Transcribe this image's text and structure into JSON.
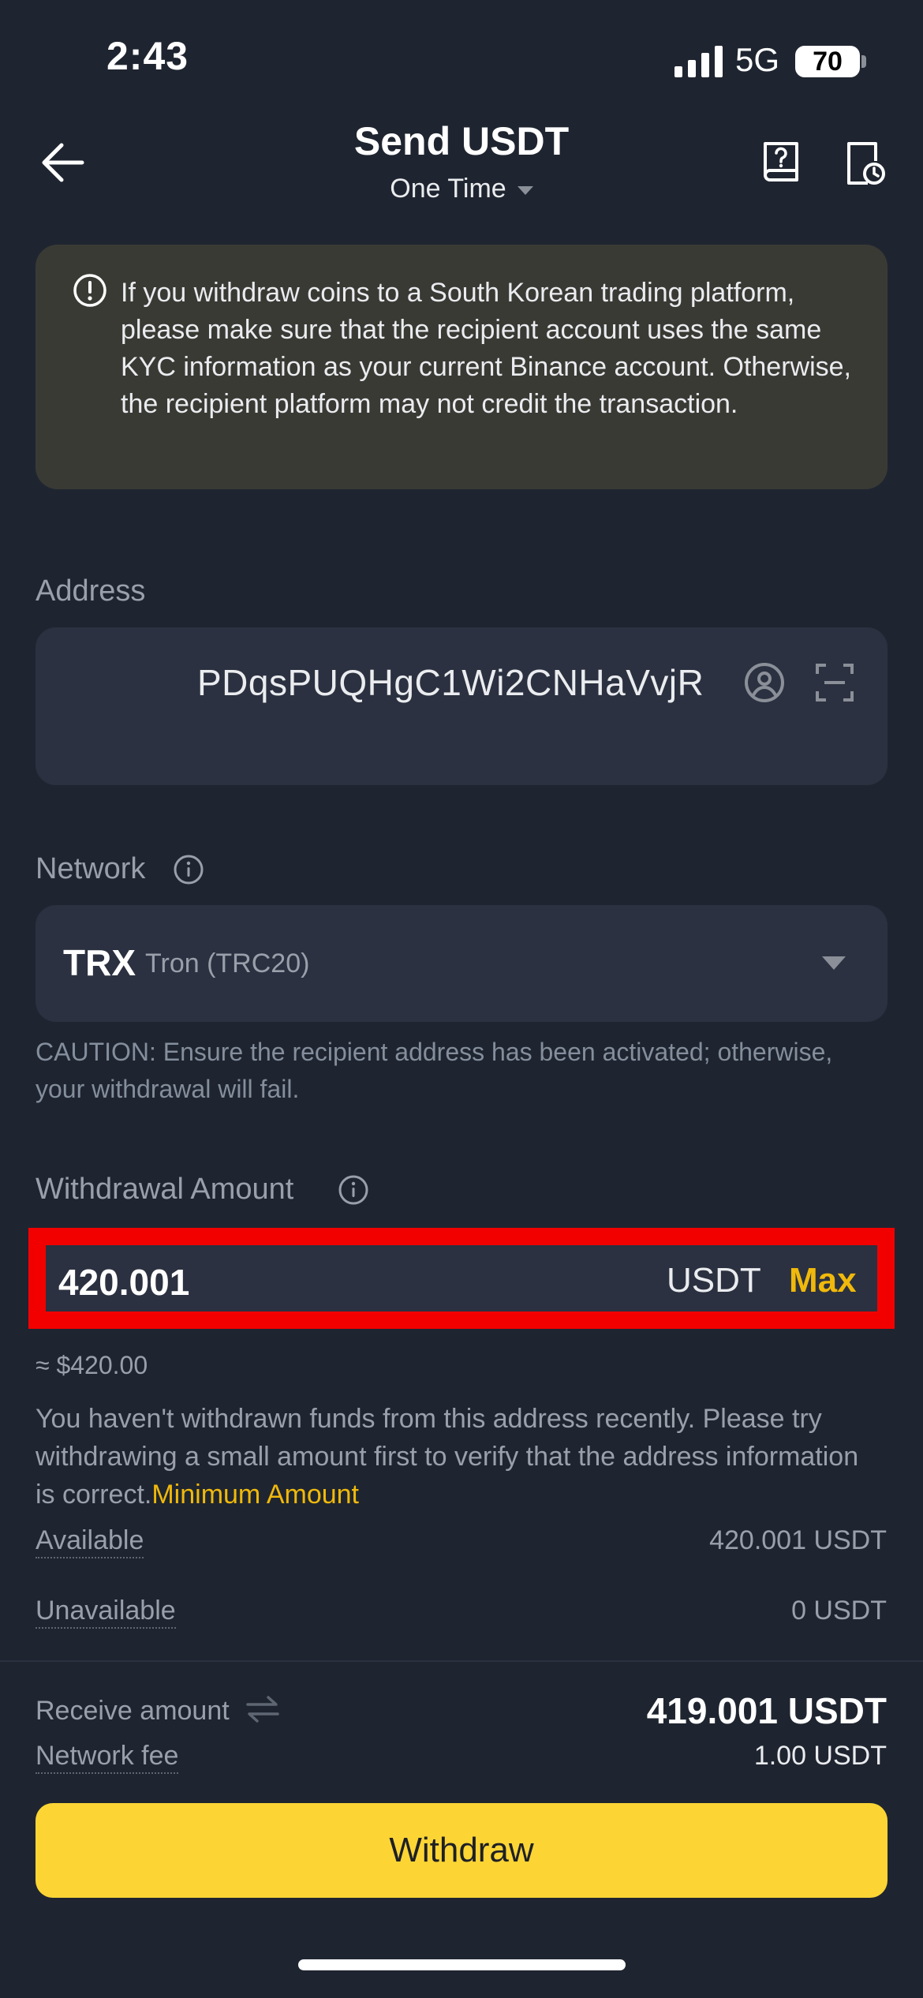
{
  "status_bar": {
    "time": "2:43",
    "network": "5G",
    "battery": "70"
  },
  "header": {
    "title": "Send USDT",
    "subtitle": "One Time"
  },
  "warning": {
    "text": "If you withdraw coins to a South Korean trading platform, please make sure that the recipient account uses the same KYC information as your current Binance account. Otherwise, the recipient platform may not credit the transaction."
  },
  "address": {
    "label": "Address",
    "value": "PDqsPUQHgC1Wi2CNHaVvjR"
  },
  "network": {
    "label": "Network",
    "symbol": "TRX",
    "name": "Tron (TRC20)",
    "caution": "CAUTION: Ensure the recipient address has been activated; otherwise, your withdrawal will fail."
  },
  "amount": {
    "label": "Withdrawal Amount",
    "value": "420.001",
    "unit": "USDT",
    "max_label": "Max",
    "approx": "≈ $420.00",
    "note": "You haven't withdrawn funds from this address recently. Please try withdrawing a small amount first to verify that the address information is correct.",
    "note_link": "Minimum Amount"
  },
  "balances": {
    "available_label": "Available",
    "available_value": "420.001 USDT",
    "unavailable_label": "Unavailable",
    "unavailable_value": "0 USDT"
  },
  "summary": {
    "receive_label": "Receive amount",
    "receive_value": "419.001 USDT",
    "fee_label": "Network fee",
    "fee_value": "1.00 USDT"
  },
  "withdraw_button": "Withdraw",
  "colors": {
    "accent": "#f0b90b",
    "button": "#fcd535",
    "highlight": "#f20000",
    "background": "#1f2530"
  }
}
